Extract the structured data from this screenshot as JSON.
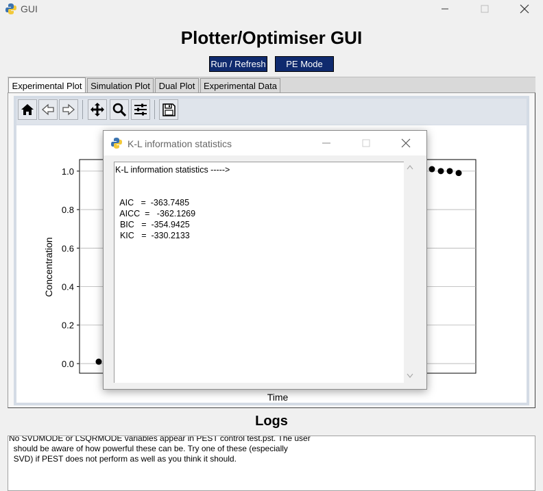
{
  "window": {
    "title": "GUI"
  },
  "app": {
    "heading": "Plotter/Optimiser GUI"
  },
  "buttons": {
    "run_refresh": "Run / Refresh",
    "pe_mode": "PE Mode"
  },
  "tabs": [
    {
      "label": "Experimental Plot",
      "active": true
    },
    {
      "label": "Simulation Plot",
      "active": false
    },
    {
      "label": "Dual Plot",
      "active": false
    },
    {
      "label": "Experimental Data",
      "active": false
    }
  ],
  "toolbar": {
    "icons": [
      "home-icon",
      "back-arrow-icon",
      "forward-arrow-icon",
      "pan-icon",
      "zoom-icon",
      "configure-subplots-icon",
      "save-icon"
    ]
  },
  "chart_data": {
    "type": "scatter",
    "xlabel": "Time",
    "ylabel": "Concentration",
    "ylim": [
      -0.05,
      1.06
    ],
    "yticks": [
      "0.0",
      "0.2",
      "0.4",
      "0.6",
      "0.8",
      "1.0"
    ],
    "yticks_values": [
      0.0,
      0.2,
      0.4,
      0.6,
      0.8,
      1.0
    ],
    "grid": "horizontal",
    "point_color": "#000000",
    "series": [
      {
        "values_visible": [
          {
            "position": "left-edge",
            "y": 0.01
          },
          {
            "position": "right-edge",
            "y": 1.01
          },
          {
            "position": "right-edge",
            "y": 1.0
          },
          {
            "position": "right-edge",
            "y": 1.0
          },
          {
            "position": "right-edge",
            "y": 0.99
          }
        ]
      }
    ]
  },
  "logs": {
    "heading": "Logs",
    "text": "No SVDMODE or LSQRMODE variables appear in PEST control test.pst. The user\n  should be aware of how powerful these can be. Try one of these (especially\n  SVD) if PEST does not perform as well as you think it should."
  },
  "dialog": {
    "title": "K-L information statistics",
    "content": "K-L information statistics ----->\n\n\n  AIC   =  -363.7485\n  AICC  =   -362.1269\n  BIC   =  -354.9425\n  KIC   =  -330.2133"
  },
  "colors": {
    "button_bg": "#0f2a6e",
    "button_text": "#ffffff",
    "toolbar_bg": "#dfe4eb"
  }
}
